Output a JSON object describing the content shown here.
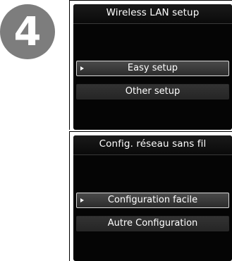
{
  "step": {
    "number": "4"
  },
  "screens": [
    {
      "title": "Wireless LAN setup",
      "items": [
        {
          "label": "Easy setup",
          "selected": true
        },
        {
          "label": "Other setup",
          "selected": false
        }
      ]
    },
    {
      "title": "Config. réseau sans fil",
      "items": [
        {
          "label": "Configuration facile",
          "selected": true
        },
        {
          "label": "Autre Configuration",
          "selected": false
        }
      ]
    }
  ],
  "colors": {
    "lcd_background": "#050505",
    "badge": "#7d7d7d",
    "highlight_border": "#d8d8d8"
  },
  "icons": {
    "cursor": "triangle-right-icon"
  }
}
